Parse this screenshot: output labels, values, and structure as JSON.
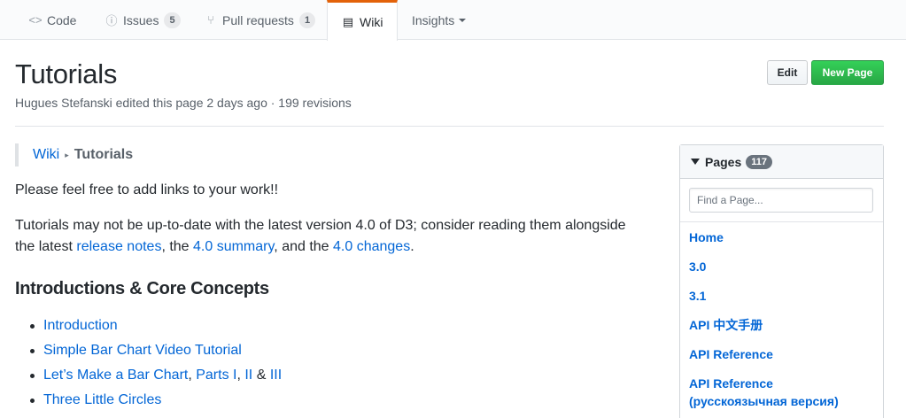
{
  "tabs": {
    "code": {
      "label": "Code"
    },
    "issues": {
      "label": "Issues",
      "count": "5"
    },
    "pull_requests": {
      "label": "Pull requests",
      "count": "1"
    },
    "wiki": {
      "label": "Wiki"
    },
    "insights": {
      "label": "Insights"
    }
  },
  "header": {
    "title": "Tutorials",
    "meta": "Hugues Stefanski edited this page 2 days ago · 199 revisions",
    "edit_label": "Edit",
    "new_page_label": "New Page"
  },
  "breadcrumb": {
    "root": "Wiki",
    "current": "Tutorials"
  },
  "content": {
    "intro": "Please feel free to add links to your work!!",
    "p2_text1": "Tutorials may not be up-to-date with the latest version 4.0 of D3; consider reading them alongside the latest ",
    "p2_link1": "release notes",
    "p2_text2": ", the ",
    "p2_link2": "4.0 summary",
    "p2_text3": ", and the ",
    "p2_link3": "4.0 changes",
    "p2_text4": ".",
    "section_heading": "Introductions & Core Concepts",
    "items": {
      "introduction": "Introduction",
      "simple_bar": "Simple Bar Chart Video Tutorial",
      "bar_chart": "Let’s Make a Bar Chart",
      "sep1": ", ",
      "parts_i": "Parts I",
      "sep2": ", ",
      "part_ii": "II",
      "amp": " & ",
      "part_iii": "III",
      "three_circles": "Three Little Circles"
    }
  },
  "sidebar": {
    "title": "Pages",
    "count": "117",
    "filter_placeholder": "Find a Page...",
    "pages": [
      "Home",
      "3.0",
      "3.1",
      "API 中文手册",
      "API Reference",
      "API Reference (русскоязычная версия)"
    ]
  }
}
